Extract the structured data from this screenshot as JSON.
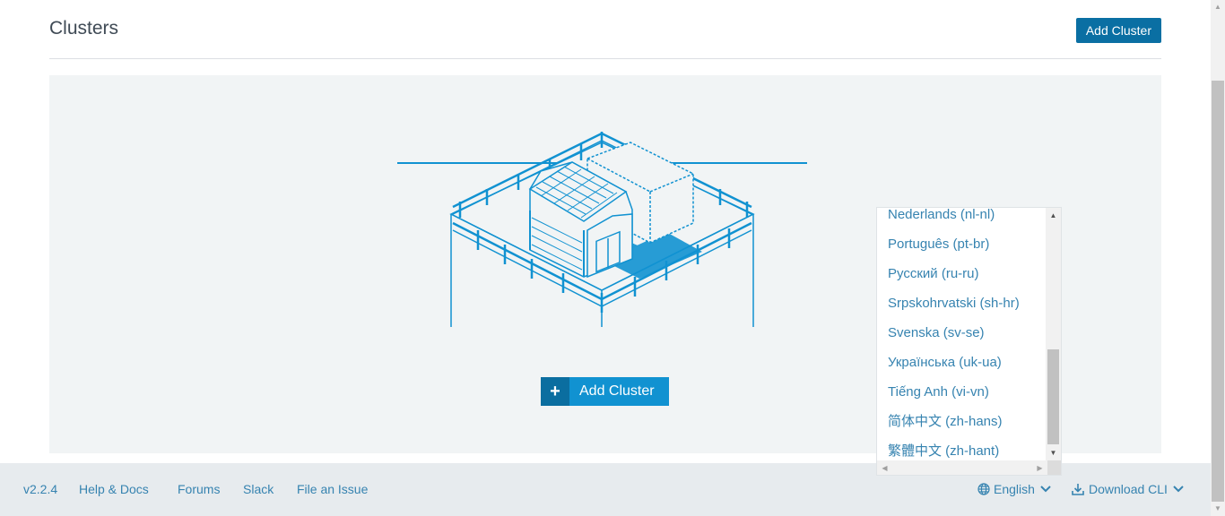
{
  "header": {
    "title": "Clusters",
    "add_cluster_label": "Add Cluster"
  },
  "empty_state": {
    "add_cluster_label": "Add Cluster",
    "plus_icon": "+"
  },
  "language_menu": {
    "items": [
      {
        "label": "Nederlands (nl-nl)"
      },
      {
        "label": "Português (pt-br)"
      },
      {
        "label": "Русский (ru-ru)"
      },
      {
        "label": "Srpskohrvatski (sh-hr)"
      },
      {
        "label": "Svenska (sv-se)"
      },
      {
        "label": "Українська (uk-ua)"
      },
      {
        "label": "Tiếng Anh (vi-vn)"
      },
      {
        "label": "简体中文 (zh-hans)"
      },
      {
        "label": "繁體中文 (zh-hant)"
      }
    ]
  },
  "footer": {
    "version": "v2.2.4",
    "help_docs": "Help & Docs",
    "forums": "Forums",
    "slack": "Slack",
    "file_issue": "File an Issue",
    "language": "English",
    "download_cli": "Download CLI"
  },
  "colors": {
    "accent": "#1192d1",
    "dark_accent": "#0a6fa3",
    "link": "#3683b0",
    "panel_bg": "#f1f4f5",
    "footer_bg": "#e7ebee"
  },
  "icons": {
    "globe": "globe-icon",
    "download": "download-icon",
    "chevron": "chevron-down-icon"
  }
}
